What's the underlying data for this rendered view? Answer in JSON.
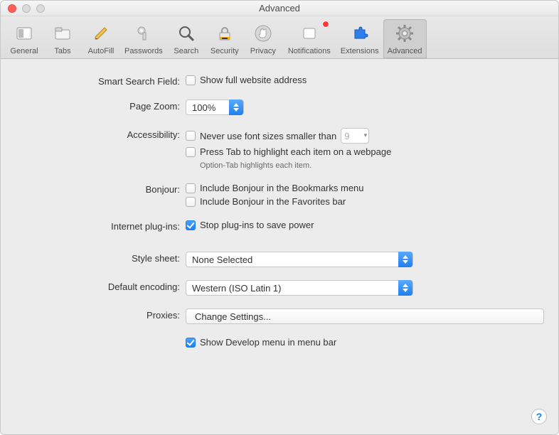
{
  "window": {
    "title": "Advanced"
  },
  "toolbar": {
    "items": [
      {
        "id": "general",
        "label": "General"
      },
      {
        "id": "tabs",
        "label": "Tabs"
      },
      {
        "id": "autofill",
        "label": "AutoFill"
      },
      {
        "id": "passwords",
        "label": "Passwords"
      },
      {
        "id": "search",
        "label": "Search"
      },
      {
        "id": "security",
        "label": "Security"
      },
      {
        "id": "privacy",
        "label": "Privacy"
      },
      {
        "id": "notifications",
        "label": "Notifications"
      },
      {
        "id": "extensions",
        "label": "Extensions"
      },
      {
        "id": "advanced",
        "label": "Advanced"
      }
    ],
    "selected": "advanced",
    "notifications_badge": true
  },
  "labels": {
    "smart_search": "Smart Search Field:",
    "page_zoom": "Page Zoom:",
    "accessibility": "Accessibility:",
    "bonjour": "Bonjour:",
    "internet_plugins": "Internet plug-ins:",
    "style_sheet": "Style sheet:",
    "default_encoding": "Default encoding:",
    "proxies": "Proxies:"
  },
  "fields": {
    "show_full_address": {
      "label": "Show full website address",
      "checked": false
    },
    "page_zoom": {
      "value": "100%"
    },
    "never_font_smaller": {
      "label": "Never use font sizes smaller than",
      "checked": false,
      "value": "9"
    },
    "press_tab": {
      "label": "Press Tab to highlight each item on a webpage",
      "checked": false
    },
    "option_tab_note": "Option-Tab highlights each item.",
    "bonjour_bookmarks": {
      "label": "Include Bonjour in the Bookmarks menu",
      "checked": false
    },
    "bonjour_favorites": {
      "label": "Include Bonjour in the Favorites bar",
      "checked": false
    },
    "stop_plugins": {
      "label": "Stop plug-ins to save power",
      "checked": true
    },
    "style_sheet": {
      "value": "None Selected"
    },
    "default_encoding": {
      "value": "Western (ISO Latin 1)"
    },
    "change_settings": "Change Settings...",
    "show_develop": {
      "label": "Show Develop menu in menu bar",
      "checked": true
    }
  },
  "help_label": "?"
}
